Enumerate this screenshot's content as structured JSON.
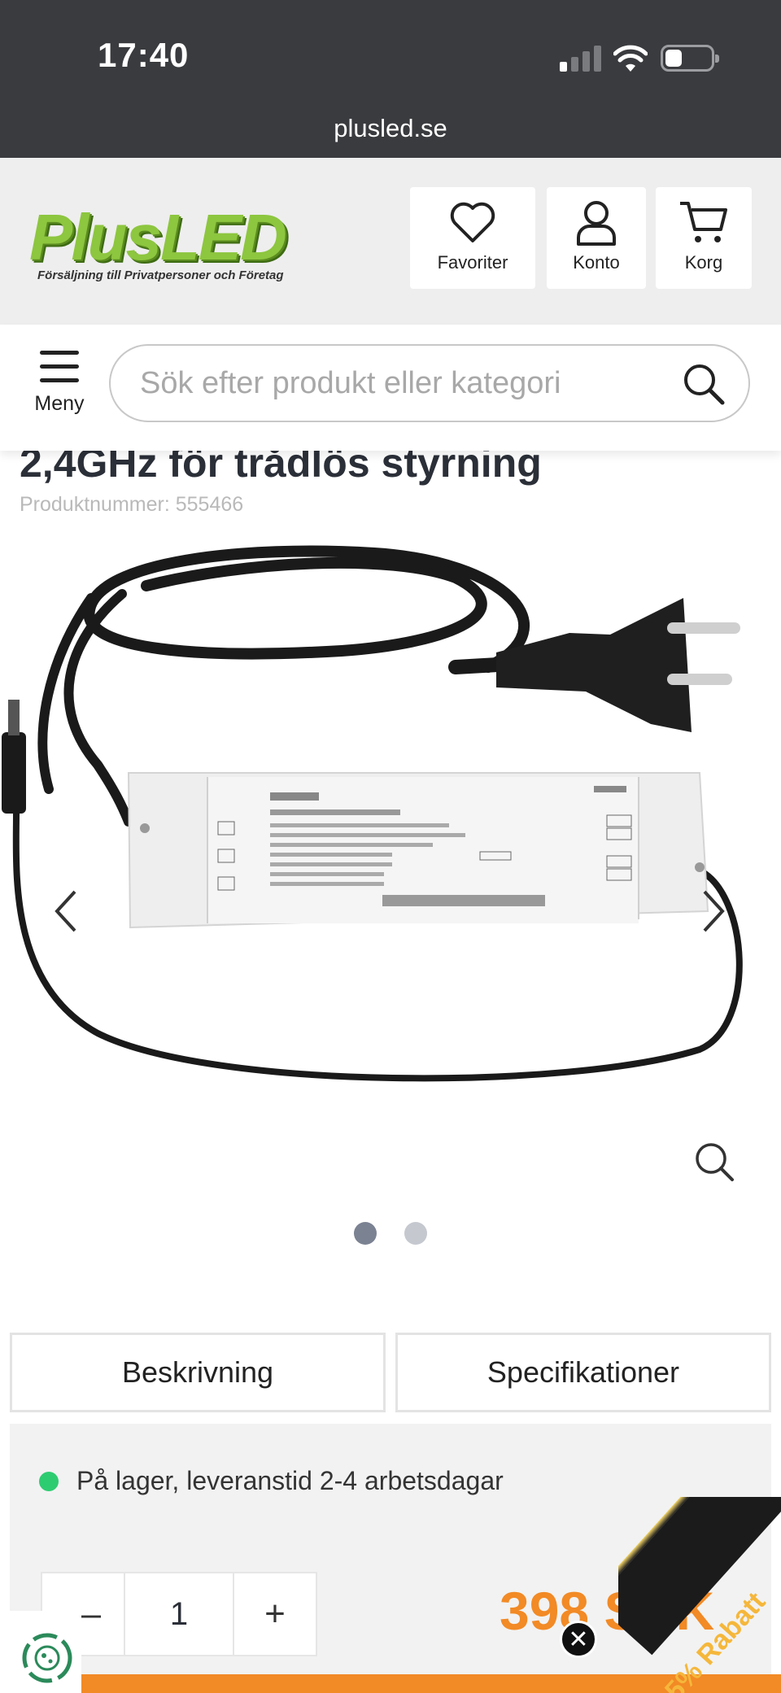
{
  "status_bar": {
    "time": "17:40",
    "url": "plusled.se"
  },
  "header": {
    "logo_text": "PlusLED",
    "logo_tagline": "Försäljning till Privatpersoner och Företag",
    "buttons": [
      {
        "label": "Favoriter",
        "icon": "heart-icon"
      },
      {
        "label": "Konto",
        "icon": "user-icon"
      },
      {
        "label": "Korg",
        "icon": "cart-icon"
      }
    ]
  },
  "nav": {
    "menu_label": "Meny",
    "search_placeholder": "Sök efter produkt eller kategori"
  },
  "product": {
    "title_partial": "2,4GHz för trådlös styrning",
    "number_label": "Produktnummer:",
    "number_value": "555466",
    "image_alt": "RF Constant Voltage LED Driver with power cable and DC plug",
    "gallery": {
      "count": 2,
      "active": 0
    }
  },
  "tabs": [
    {
      "label": "Beskrivning"
    },
    {
      "label": "Specifikationer"
    }
  ],
  "purchase": {
    "stock_text": "På lager, leveranstid 2-4 arbetsdagar",
    "quantity": "1",
    "price": "398 SEK",
    "promo": "5% Rabatt"
  },
  "colors": {
    "accent_orange": "#f28a25",
    "brand_green": "#8dc63f",
    "stock_green": "#2ecc71",
    "statusbar": "#3a3b3e"
  }
}
